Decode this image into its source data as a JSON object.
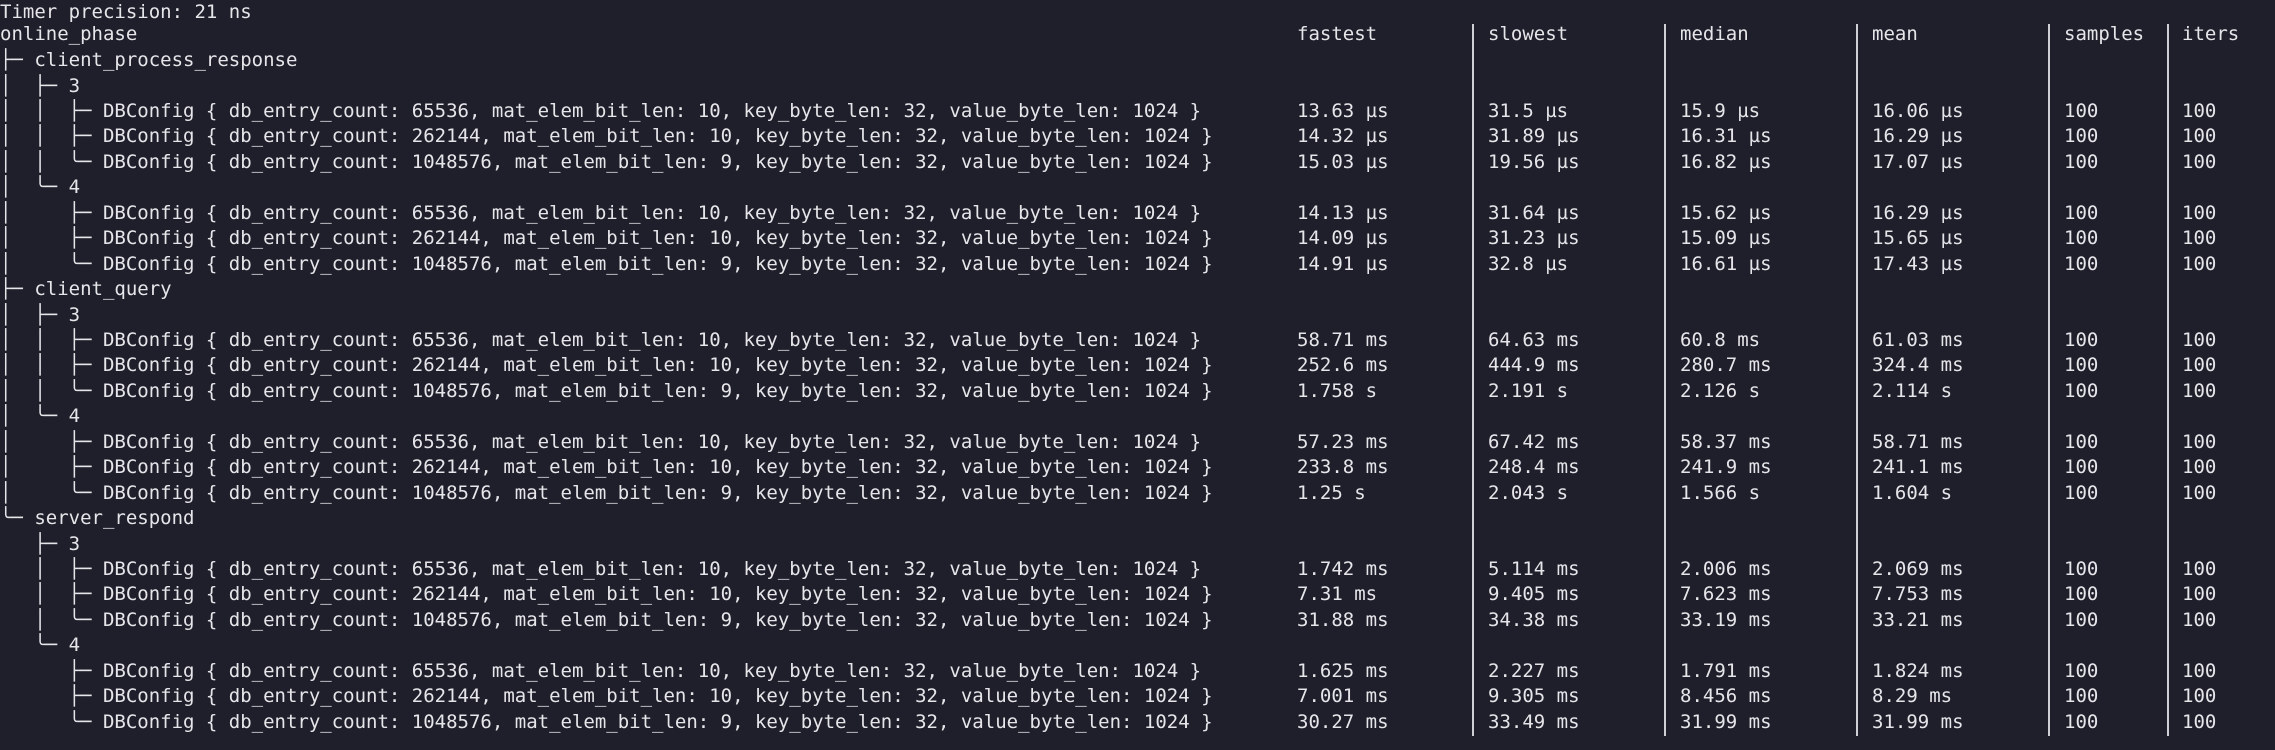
{
  "terminal": {
    "timer_line": "Timer precision: 21 ns",
    "root_label": "online_phase",
    "headers": {
      "fastest": "fastest",
      "slowest": "slowest",
      "median": "median",
      "mean": "mean",
      "samples": "samples",
      "iters": "iters"
    }
  },
  "rows": [
    {
      "text": "├─ client_process_response"
    },
    {
      "text": "│  ├─ 3"
    },
    {
      "text": "│  │  ├─ DBConfig { db_entry_count: 65536, mat_elem_bit_len: 10, key_byte_len: 32, value_byte_len: 1024 }",
      "fastest": "13.63 µs",
      "slowest": "31.5 µs",
      "median": "15.9 µs",
      "mean": "16.06 µs",
      "samples": "100",
      "iters": "100"
    },
    {
      "text": "│  │  ├─ DBConfig { db_entry_count: 262144, mat_elem_bit_len: 10, key_byte_len: 32, value_byte_len: 1024 }",
      "fastest": "14.32 µs",
      "slowest": "31.89 µs",
      "median": "16.31 µs",
      "mean": "16.29 µs",
      "samples": "100",
      "iters": "100"
    },
    {
      "text": "│  │  ╰─ DBConfig { db_entry_count: 1048576, mat_elem_bit_len: 9, key_byte_len: 32, value_byte_len: 1024 }",
      "fastest": "15.03 µs",
      "slowest": "19.56 µs",
      "median": "16.82 µs",
      "mean": "17.07 µs",
      "samples": "100",
      "iters": "100"
    },
    {
      "text": "│  ╰─ 4"
    },
    {
      "text": "│     ├─ DBConfig { db_entry_count: 65536, mat_elem_bit_len: 10, key_byte_len: 32, value_byte_len: 1024 }",
      "fastest": "14.13 µs",
      "slowest": "31.64 µs",
      "median": "15.62 µs",
      "mean": "16.29 µs",
      "samples": "100",
      "iters": "100"
    },
    {
      "text": "│     ├─ DBConfig { db_entry_count: 262144, mat_elem_bit_len: 10, key_byte_len: 32, value_byte_len: 1024 }",
      "fastest": "14.09 µs",
      "slowest": "31.23 µs",
      "median": "15.09 µs",
      "mean": "15.65 µs",
      "samples": "100",
      "iters": "100"
    },
    {
      "text": "│     ╰─ DBConfig { db_entry_count: 1048576, mat_elem_bit_len: 9, key_byte_len: 32, value_byte_len: 1024 }",
      "fastest": "14.91 µs",
      "slowest": "32.8 µs",
      "median": "16.61 µs",
      "mean": "17.43 µs",
      "samples": "100",
      "iters": "100"
    },
    {
      "text": "├─ client_query"
    },
    {
      "text": "│  ├─ 3"
    },
    {
      "text": "│  │  ├─ DBConfig { db_entry_count: 65536, mat_elem_bit_len: 10, key_byte_len: 32, value_byte_len: 1024 }",
      "fastest": "58.71 ms",
      "slowest": "64.63 ms",
      "median": "60.8 ms",
      "mean": "61.03 ms",
      "samples": "100",
      "iters": "100"
    },
    {
      "text": "│  │  ├─ DBConfig { db_entry_count: 262144, mat_elem_bit_len: 10, key_byte_len: 32, value_byte_len: 1024 }",
      "fastest": "252.6 ms",
      "slowest": "444.9 ms",
      "median": "280.7 ms",
      "mean": "324.4 ms",
      "samples": "100",
      "iters": "100"
    },
    {
      "text": "│  │  ╰─ DBConfig { db_entry_count: 1048576, mat_elem_bit_len: 9, key_byte_len: 32, value_byte_len: 1024 }",
      "fastest": "1.758 s",
      "slowest": "2.191 s",
      "median": "2.126 s",
      "mean": "2.114 s",
      "samples": "100",
      "iters": "100"
    },
    {
      "text": "│  ╰─ 4"
    },
    {
      "text": "│     ├─ DBConfig { db_entry_count: 65536, mat_elem_bit_len: 10, key_byte_len: 32, value_byte_len: 1024 }",
      "fastest": "57.23 ms",
      "slowest": "67.42 ms",
      "median": "58.37 ms",
      "mean": "58.71 ms",
      "samples": "100",
      "iters": "100"
    },
    {
      "text": "│     ├─ DBConfig { db_entry_count: 262144, mat_elem_bit_len: 10, key_byte_len: 32, value_byte_len: 1024 }",
      "fastest": "233.8 ms",
      "slowest": "248.4 ms",
      "median": "241.9 ms",
      "mean": "241.1 ms",
      "samples": "100",
      "iters": "100"
    },
    {
      "text": "│     ╰─ DBConfig { db_entry_count: 1048576, mat_elem_bit_len: 9, key_byte_len: 32, value_byte_len: 1024 }",
      "fastest": "1.25 s",
      "slowest": "2.043 s",
      "median": "1.566 s",
      "mean": "1.604 s",
      "samples": "100",
      "iters": "100"
    },
    {
      "text": "╰─ server_respond"
    },
    {
      "text": "   ├─ 3"
    },
    {
      "text": "   │  ├─ DBConfig { db_entry_count: 65536, mat_elem_bit_len: 10, key_byte_len: 32, value_byte_len: 1024 }",
      "fastest": "1.742 ms",
      "slowest": "5.114 ms",
      "median": "2.006 ms",
      "mean": "2.069 ms",
      "samples": "100",
      "iters": "100"
    },
    {
      "text": "   │  ├─ DBConfig { db_entry_count: 262144, mat_elem_bit_len: 10, key_byte_len: 32, value_byte_len: 1024 }",
      "fastest": "7.31 ms",
      "slowest": "9.405 ms",
      "median": "7.623 ms",
      "mean": "7.753 ms",
      "samples": "100",
      "iters": "100"
    },
    {
      "text": "   │  ╰─ DBConfig { db_entry_count: 1048576, mat_elem_bit_len: 9, key_byte_len: 32, value_byte_len: 1024 }",
      "fastest": "31.88 ms",
      "slowest": "34.38 ms",
      "median": "33.19 ms",
      "mean": "33.21 ms",
      "samples": "100",
      "iters": "100"
    },
    {
      "text": "   ╰─ 4"
    },
    {
      "text": "      ├─ DBConfig { db_entry_count: 65536, mat_elem_bit_len: 10, key_byte_len: 32, value_byte_len: 1024 }",
      "fastest": "1.625 ms",
      "slowest": "2.227 ms",
      "median": "1.791 ms",
      "mean": "1.824 ms",
      "samples": "100",
      "iters": "100"
    },
    {
      "text": "      ├─ DBConfig { db_entry_count: 262144, mat_elem_bit_len: 10, key_byte_len: 32, value_byte_len: 1024 }",
      "fastest": "7.001 ms",
      "slowest": "9.305 ms",
      "median": "8.456 ms",
      "mean": "8.29 ms",
      "samples": "100",
      "iters": "100"
    },
    {
      "text": "      ╰─ DBConfig { db_entry_count: 1048576, mat_elem_bit_len: 9, key_byte_len: 32, value_byte_len: 1024 }",
      "fastest": "30.27 ms",
      "slowest": "33.49 ms",
      "median": "31.99 ms",
      "mean": "31.99 ms",
      "samples": "100",
      "iters": "100"
    }
  ]
}
